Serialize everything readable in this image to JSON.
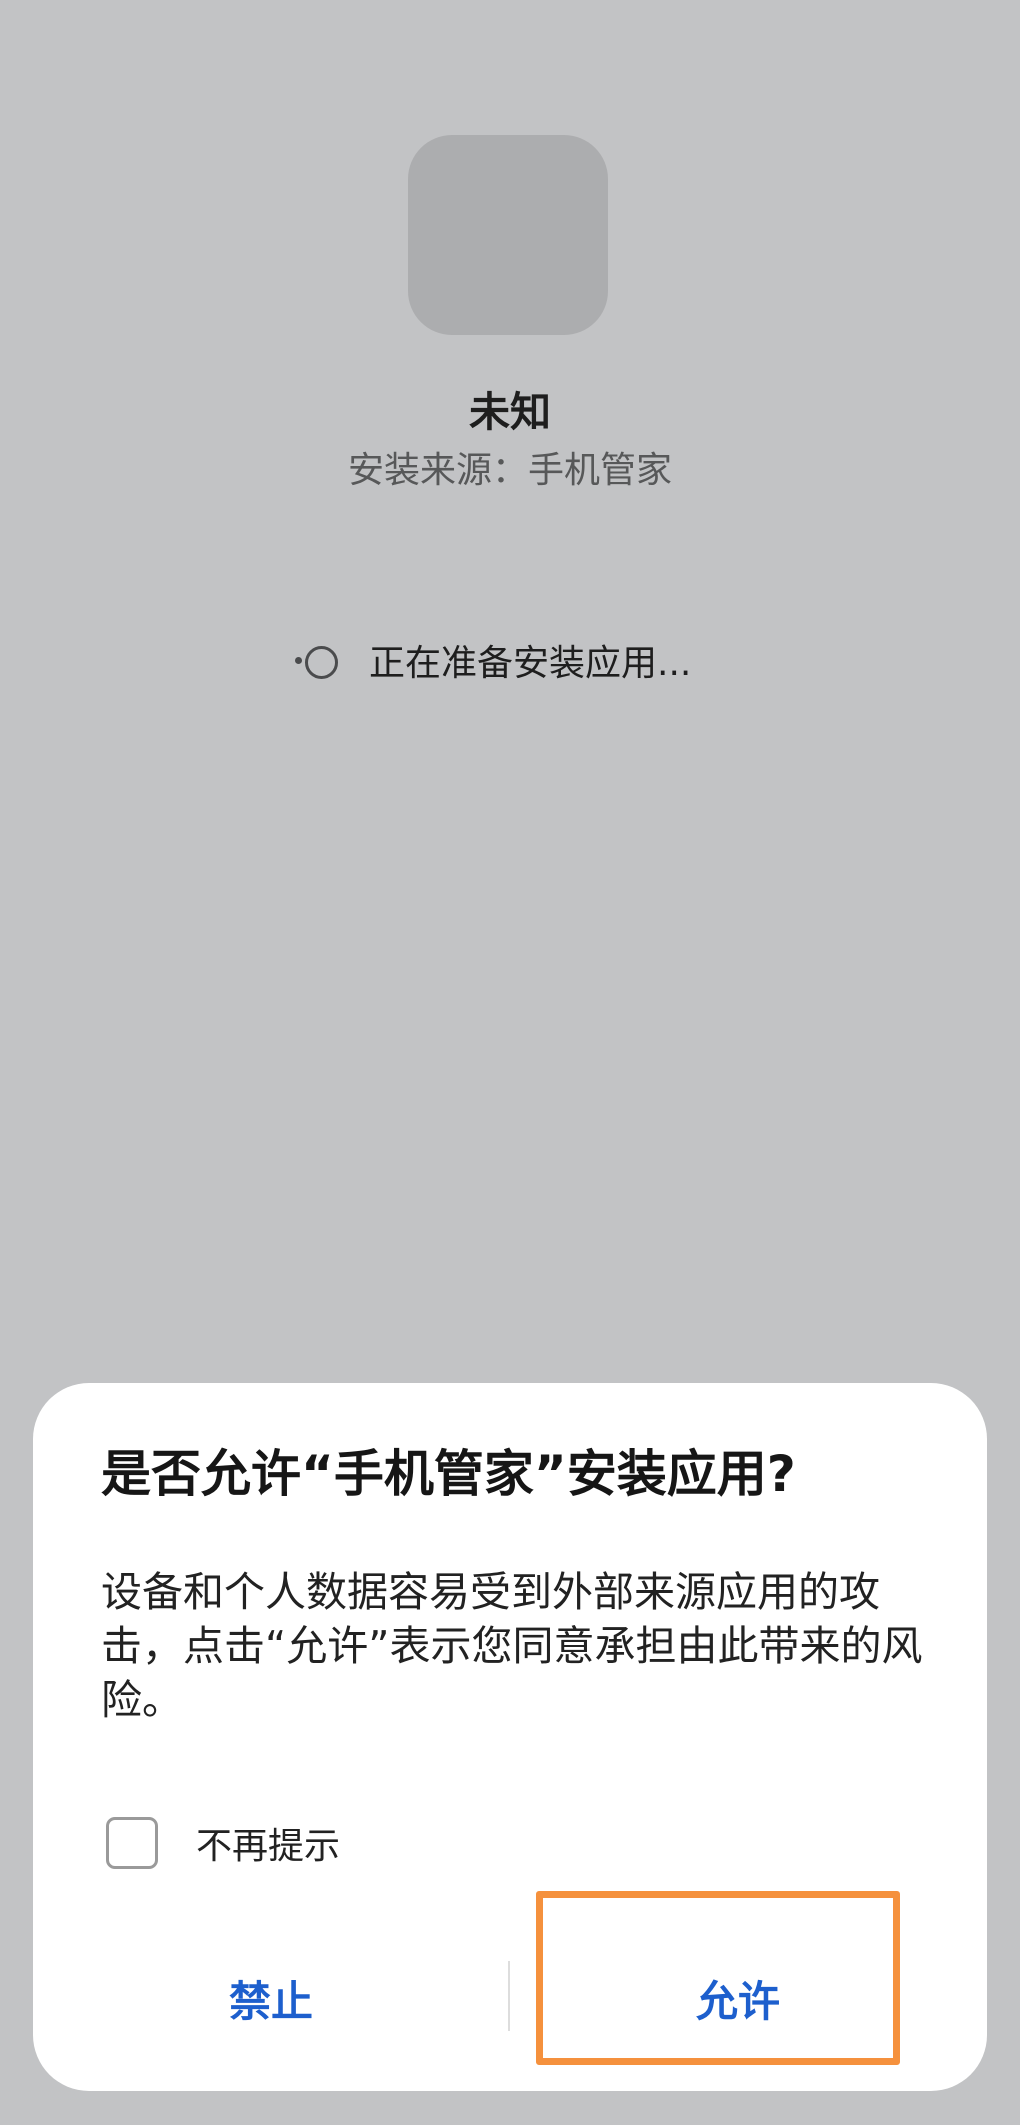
{
  "app": {
    "name": "未知",
    "install_source": "安装来源：手机管家",
    "loading_text": "正在准备安装应用..."
  },
  "dialog": {
    "title": "是否允许“手机管家”安装应用?",
    "message": "设备和个人数据容易受到外部来源应用的攻击，点击“允许”表示您同意承担由此带来的风险。",
    "checkbox_label": "不再提示",
    "checkbox_checked": false,
    "deny_label": "禁止",
    "allow_label": "允许"
  },
  "colors": {
    "background": "#c2c3c5",
    "button_text": "#1d5fcd",
    "highlight": "#f5913d"
  }
}
